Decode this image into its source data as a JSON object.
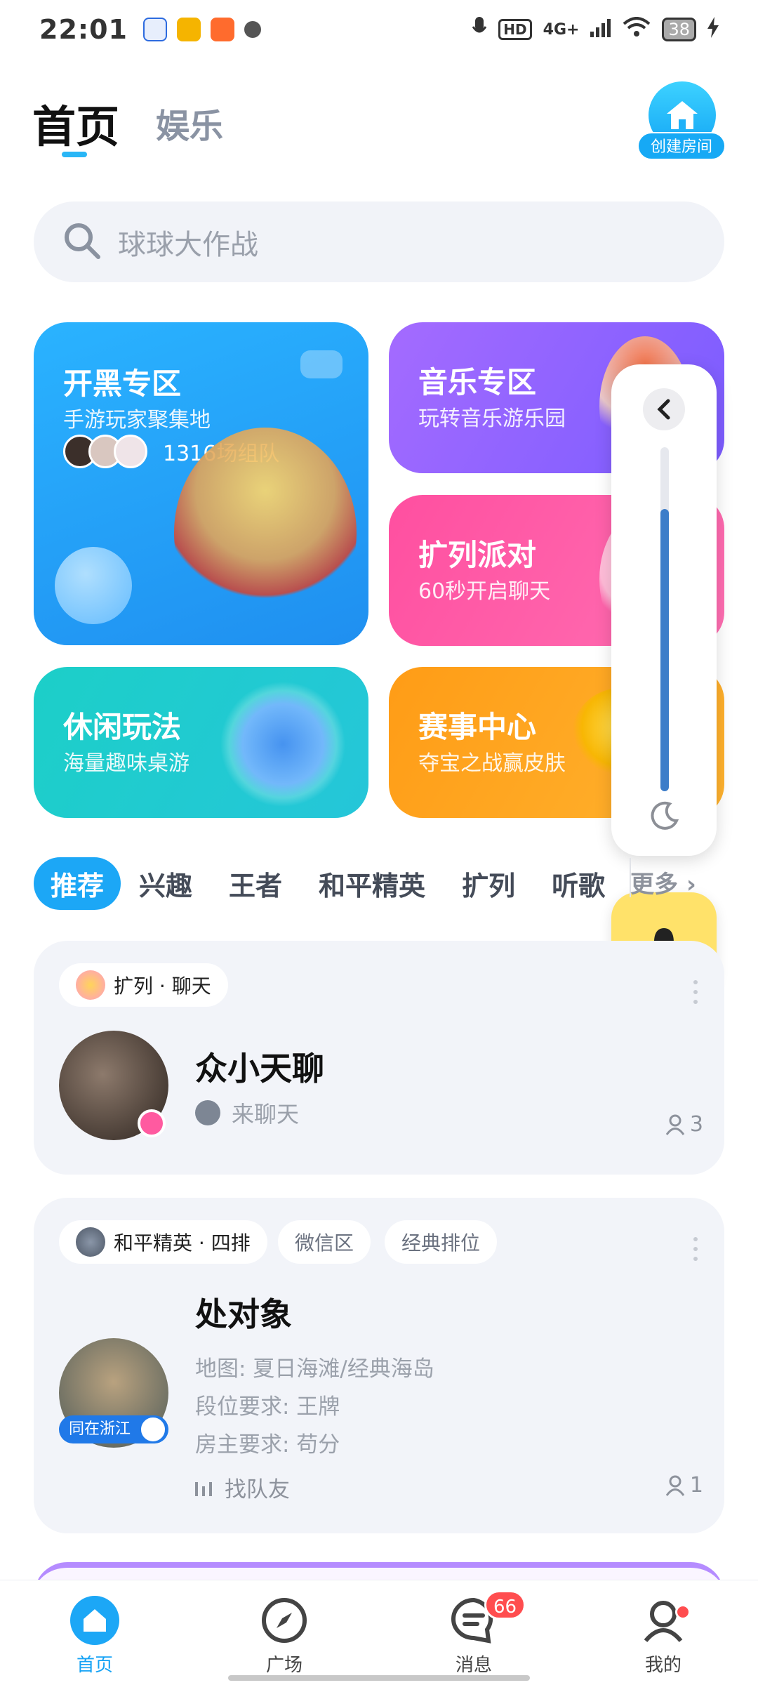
{
  "status_bar": {
    "time": "22:01",
    "network": "4G+",
    "battery": "38"
  },
  "header": {
    "tab_home": "首页",
    "tab_entertainment": "娱乐",
    "create_room_label": "创建房间"
  },
  "search": {
    "placeholder": "球球大作战"
  },
  "cards": {
    "blue": {
      "title": "开黑专区",
      "subtitle": "手游玩家聚集地",
      "count": "1316场组队"
    },
    "purple": {
      "title": "音乐专区",
      "subtitle": "玩转音乐游乐园"
    },
    "pink": {
      "title": "扩列派对",
      "subtitle": "60秒开启聊天"
    },
    "teal": {
      "title": "休闲玩法",
      "subtitle": "海量趣味桌游"
    },
    "orange": {
      "title": "赛事中心",
      "subtitle": "夺宝之战赢皮肤"
    }
  },
  "float_panel": {
    "level": 0.82
  },
  "categories": {
    "items": [
      "推荐",
      "兴趣",
      "王者",
      "和平精英",
      "扩列",
      "听歌"
    ],
    "more": "更多"
  },
  "rooms": [
    {
      "tag": "扩列 · 聊天",
      "name": "众小天聊",
      "host": "来聊天",
      "people": "3"
    },
    {
      "tags": [
        "和平精英 · 四排",
        "微信区",
        "经典排位"
      ],
      "name": "处对象",
      "details": [
        "地图: 夏日海滩/经典海岛",
        "段位要求: 王牌",
        "房主要求: 苟分"
      ],
      "find": "找队友",
      "people": "1",
      "location": "同在浙江"
    }
  ],
  "bottom_nav": {
    "home": "首页",
    "plaza": "广场",
    "messages": "消息",
    "messages_badge": "66",
    "me": "我的"
  },
  "colors": {
    "accent": "#1ca7f6",
    "badge": "#ff4d4f"
  }
}
